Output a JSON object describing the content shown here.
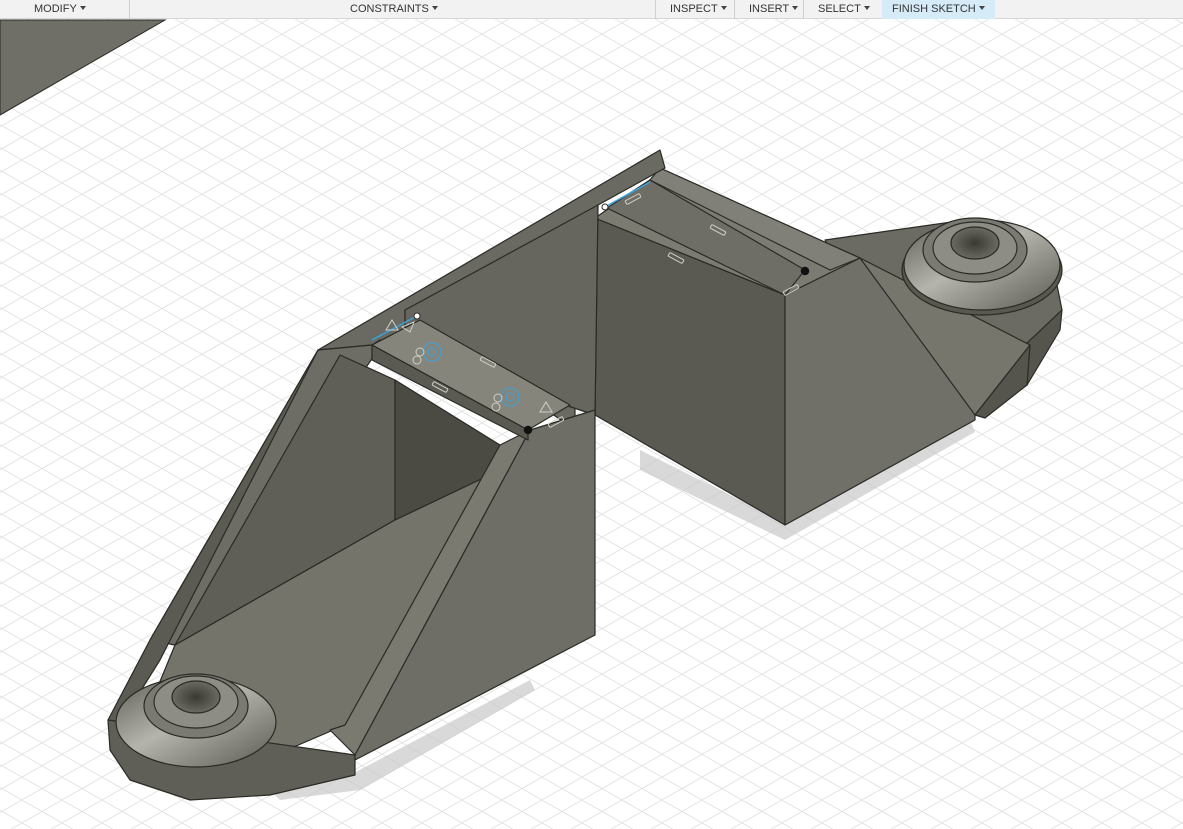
{
  "toolbar": {
    "modify_label": "MODIFY",
    "constraints_label": "CONSTRAINTS",
    "inspect_label": "INSPECT",
    "insert_label": "INSERT",
    "select_label": "SELECT",
    "finish_sketch_label": "FINISH SKETCH"
  },
  "colors": {
    "toolbar_bg": "#f2f2f2",
    "active_button_bg": "#d5ebf7",
    "grid_line": "#e6e6e6",
    "model_face_light": "#7d7d74",
    "model_face_mid": "#6c6c63",
    "model_face_dark": "#56564e",
    "model_edge": "#2a2a26",
    "sketch_line": "#3aa3e0"
  }
}
